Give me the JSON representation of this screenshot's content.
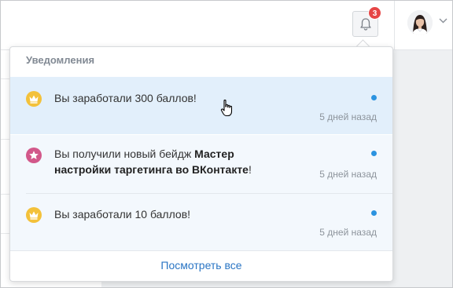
{
  "header": {
    "notifications_badge": "3"
  },
  "dropdown": {
    "title": "Уведомления",
    "items": [
      {
        "icon": "crown-icon",
        "text": "Вы заработали 300 баллов!",
        "time": "5 дней назад",
        "unread": true
      },
      {
        "icon": "star-icon",
        "text_prefix": "Вы получили новый бейдж ",
        "text_bold": "Мастер настройки таргетинга во ВКонтакте",
        "text_suffix": "!",
        "time": "5 дней назад",
        "unread": true
      },
      {
        "icon": "crown-icon",
        "text": "Вы заработали 10 баллов!",
        "time": "5 дней назад",
        "unread": true
      }
    ],
    "view_all": "Посмотреть все"
  },
  "colors": {
    "accent": "#2a75c4",
    "badge": "#e64646",
    "unread_dot": "#2b93e0",
    "crown_bg": "#f3c13a",
    "star_bg": "#d2588a",
    "highlight": "#e2effb"
  }
}
